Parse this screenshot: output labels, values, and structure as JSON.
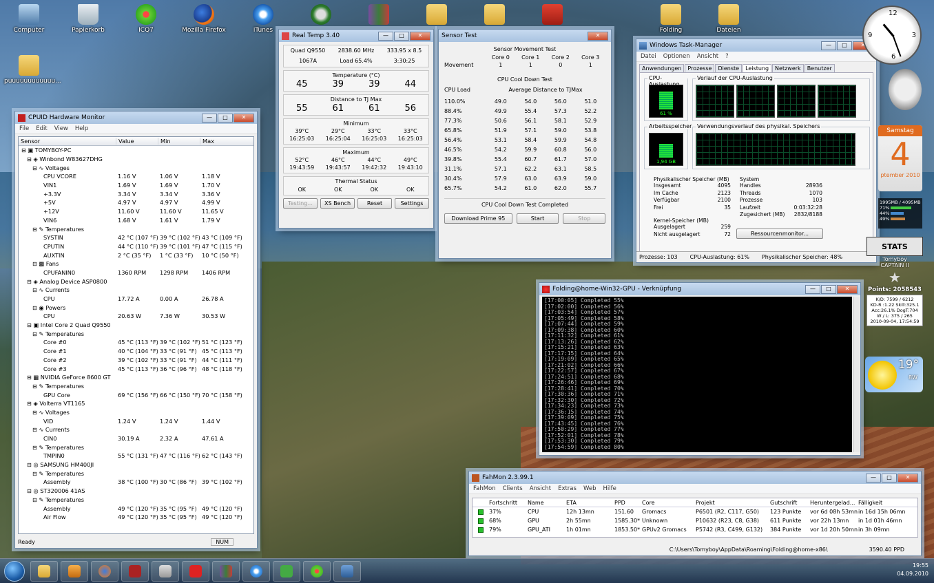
{
  "desktop": {
    "icons": [
      {
        "label": "Computer"
      },
      {
        "label": "Papierkorb"
      },
      {
        "label": "ICQ7"
      },
      {
        "label": "Mozilla Firefox"
      },
      {
        "label": "iTunes"
      },
      {
        "label": ""
      },
      {
        "label": ""
      },
      {
        "label": ""
      },
      {
        "label": ""
      },
      {
        "label": ""
      },
      {
        "label": "Folding"
      },
      {
        "label": "Dateien"
      },
      {
        "label": "puuuuuuuuuuuu..."
      }
    ]
  },
  "hwmon": {
    "title": "CPUID Hardware Monitor",
    "menu": [
      "File",
      "Edit",
      "View",
      "Help"
    ],
    "columns": [
      "Sensor",
      "Value",
      "Min",
      "Max"
    ],
    "rows": [
      {
        "sensor": "⊟ ▣ TOMYBOY-PC",
        "value": "",
        "min": "",
        "max": "",
        "indent": 0
      },
      {
        "sensor": "⊟ ◈ Winbond W83627DHG",
        "value": "",
        "min": "",
        "max": "",
        "indent": 1
      },
      {
        "sensor": "⊟ ∿ Voltages",
        "value": "",
        "min": "",
        "max": "",
        "indent": 2
      },
      {
        "sensor": "CPU VCORE",
        "value": "1.16 V",
        "min": "1.06 V",
        "max": "1.18 V",
        "indent": 4
      },
      {
        "sensor": "VIN1",
        "value": "1.69 V",
        "min": "1.69 V",
        "max": "1.70 V",
        "indent": 4
      },
      {
        "sensor": "+3.3V",
        "value": "3.34 V",
        "min": "3.34 V",
        "max": "3.36 V",
        "indent": 4
      },
      {
        "sensor": "+5V",
        "value": "4.97 V",
        "min": "4.97 V",
        "max": "4.99 V",
        "indent": 4
      },
      {
        "sensor": "+12V",
        "value": "11.60 V",
        "min": "11.60 V",
        "max": "11.65 V",
        "indent": 4
      },
      {
        "sensor": "VIN6",
        "value": "1.68 V",
        "min": "1.61 V",
        "max": "1.79 V",
        "indent": 4
      },
      {
        "sensor": "⊟ ✎ Temperatures",
        "value": "",
        "min": "",
        "max": "",
        "indent": 2
      },
      {
        "sensor": "SYSTIN",
        "value": "42 °C (107 °F)",
        "min": "39 °C (102 °F)",
        "max": "43 °C (109 °F)",
        "indent": 4
      },
      {
        "sensor": "CPUTIN",
        "value": "44 °C (110 °F)",
        "min": "39 °C (101 °F)",
        "max": "47 °C (115 °F)",
        "indent": 4
      },
      {
        "sensor": "AUXTIN",
        "value": "2 °C (35 °F)",
        "min": "1 °C (33 °F)",
        "max": "10 °C (50 °F)",
        "indent": 4
      },
      {
        "sensor": "⊟ ▩ Fans",
        "value": "",
        "min": "",
        "max": "",
        "indent": 2
      },
      {
        "sensor": "CPUFANIN0",
        "value": "1360 RPM",
        "min": "1298 RPM",
        "max": "1406 RPM",
        "indent": 4
      },
      {
        "sensor": "⊟ ◈ Analog Device ASP0800",
        "value": "",
        "min": "",
        "max": "",
        "indent": 1
      },
      {
        "sensor": "⊟ ∿ Currents",
        "value": "",
        "min": "",
        "max": "",
        "indent": 2
      },
      {
        "sensor": "CPU",
        "value": "17.72 A",
        "min": "0.00 A",
        "max": "26.78 A",
        "indent": 4
      },
      {
        "sensor": "⊟ ◉ Powers",
        "value": "",
        "min": "",
        "max": "",
        "indent": 2
      },
      {
        "sensor": "CPU",
        "value": "20.63 W",
        "min": "7.36 W",
        "max": "30.53 W",
        "indent": 4
      },
      {
        "sensor": "⊟ ▣ Intel Core 2 Quad Q9550",
        "value": "",
        "min": "",
        "max": "",
        "indent": 1
      },
      {
        "sensor": "⊟ ✎ Temperatures",
        "value": "",
        "min": "",
        "max": "",
        "indent": 2
      },
      {
        "sensor": "Core #0",
        "value": "45 °C (113 °F)",
        "min": "39 °C (102 °F)",
        "max": "51 °C (123 °F)",
        "indent": 4
      },
      {
        "sensor": "Core #1",
        "value": "40 °C (104 °F)",
        "min": "33 °C (91 °F)",
        "max": "45 °C (113 °F)",
        "indent": 4
      },
      {
        "sensor": "Core #2",
        "value": "39 °C (102 °F)",
        "min": "33 °C (91 °F)",
        "max": "44 °C (111 °F)",
        "indent": 4
      },
      {
        "sensor": "Core #3",
        "value": "45 °C (113 °F)",
        "min": "36 °C (96 °F)",
        "max": "48 °C (118 °F)",
        "indent": 4
      },
      {
        "sensor": "⊟ ▦ NVIDIA GeForce 8600 GT",
        "value": "",
        "min": "",
        "max": "",
        "indent": 1
      },
      {
        "sensor": "⊟ ✎ Temperatures",
        "value": "",
        "min": "",
        "max": "",
        "indent": 2
      },
      {
        "sensor": "GPU Core",
        "value": "69 °C (156 °F)",
        "min": "66 °C (150 °F)",
        "max": "70 °C (158 °F)",
        "indent": 4
      },
      {
        "sensor": "⊟ ◈ Volterra VT1165",
        "value": "",
        "min": "",
        "max": "",
        "indent": 1
      },
      {
        "sensor": "⊟ ∿ Voltages",
        "value": "",
        "min": "",
        "max": "",
        "indent": 2
      },
      {
        "sensor": "VID",
        "value": "1.24 V",
        "min": "1.24 V",
        "max": "1.44 V",
        "indent": 4
      },
      {
        "sensor": "⊟ ∿ Currents",
        "value": "",
        "min": "",
        "max": "",
        "indent": 2
      },
      {
        "sensor": "CIN0",
        "value": "30.19 A",
        "min": "2.32 A",
        "max": "47.61 A",
        "indent": 4
      },
      {
        "sensor": "⊟ ✎ Temperatures",
        "value": "",
        "min": "",
        "max": "",
        "indent": 2
      },
      {
        "sensor": "TMPIN0",
        "value": "55 °C (131 °F)",
        "min": "47 °C (116 °F)",
        "max": "62 °C (143 °F)",
        "indent": 4
      },
      {
        "sensor": "⊟ ◎ SAMSUNG HM400JI",
        "value": "",
        "min": "",
        "max": "",
        "indent": 1
      },
      {
        "sensor": "⊟ ✎ Temperatures",
        "value": "",
        "min": "",
        "max": "",
        "indent": 2
      },
      {
        "sensor": "Assembly",
        "value": "38 °C (100 °F)",
        "min": "30 °C (86 °F)",
        "max": "39 °C (102 °F)",
        "indent": 4
      },
      {
        "sensor": "⊟ ◎ ST320006 41AS",
        "value": "",
        "min": "",
        "max": "",
        "indent": 1
      },
      {
        "sensor": "⊟ ✎ Temperatures",
        "value": "",
        "min": "",
        "max": "",
        "indent": 2
      },
      {
        "sensor": "Assembly",
        "value": "49 °C (120 °F)",
        "min": "35 °C (95 °F)",
        "max": "49 °C (120 °F)",
        "indent": 4
      },
      {
        "sensor": "Air Flow",
        "value": "49 °C (120 °F)",
        "min": "35 °C (95 °F)",
        "max": "49 °C (120 °F)",
        "indent": 4
      }
    ],
    "status": "Ready",
    "num": "NUM"
  },
  "realtemp": {
    "title": "Real Temp 3.40",
    "cpu": "Quad Q9550",
    "mhz": "2838.60 MHz",
    "mult": "333.95 x 8.5",
    "vid": "1067A",
    "load": "Load  65.4%",
    "time": "3:30:25",
    "temp_label": "Temperature (°C)",
    "temps": [
      "45",
      "39",
      "39",
      "44"
    ],
    "tj_label": "Distance to TJ Max",
    "tj": [
      "55",
      "61",
      "61",
      "56"
    ],
    "min_label": "Minimum",
    "min_t": [
      "39°C",
      "29°C",
      "33°C",
      "33°C"
    ],
    "min_time": [
      "16:25:03",
      "16:25:04",
      "16:25:03",
      "16:25:03"
    ],
    "max_label": "Maximum",
    "max_t": [
      "52°C",
      "46°C",
      "44°C",
      "49°C"
    ],
    "max_time": [
      "19:43:59",
      "19:43:57",
      "19:42:32",
      "19:43:10"
    ],
    "thermal_label": "Thermal Status",
    "thermal": [
      "OK",
      "OK",
      "OK",
      "OK"
    ],
    "buttons": [
      "Testing...",
      "XS Bench",
      "Reset",
      "Settings"
    ]
  },
  "sensortest": {
    "title": "Sensor Test",
    "movement_title": "Sensor Movement Test",
    "cores": [
      "Core 0",
      "Core 1",
      "Core 2",
      "Core 3"
    ],
    "movement_label": "Movement",
    "movement": [
      "1",
      "1",
      "0",
      "1"
    ],
    "cooldown_title": "CPU Cool Down Test",
    "cpu_load_label": "CPU Load",
    "avg_label": "Average Distance to TJMax",
    "rows": [
      [
        "110.0%",
        "49.0",
        "54.0",
        "56.0",
        "51.0"
      ],
      [
        "88.4%",
        "49.9",
        "55.4",
        "57.3",
        "52.2"
      ],
      [
        "77.3%",
        "50.6",
        "56.1",
        "58.1",
        "52.9"
      ],
      [
        "65.8%",
        "51.9",
        "57.1",
        "59.0",
        "53.8"
      ],
      [
        "56.4%",
        "53.1",
        "58.4",
        "59.9",
        "54.8"
      ],
      [
        "46.5%",
        "54.2",
        "59.9",
        "60.8",
        "56.0"
      ],
      [
        "39.8%",
        "55.4",
        "60.7",
        "61.7",
        "57.0"
      ],
      [
        "31.1%",
        "57.1",
        "62.2",
        "63.1",
        "58.5"
      ],
      [
        "30.4%",
        "57.9",
        "63.0",
        "63.9",
        "59.0"
      ],
      [
        "65.7%",
        "54.2",
        "61.0",
        "62.0",
        "55.7"
      ]
    ],
    "completed": "CPU Cool Down Test Completed",
    "btn_download": "Download Prime 95",
    "btn_start": "Start",
    "btn_stop": "Stop"
  },
  "taskmgr": {
    "title": "Windows Task-Manager",
    "menu": [
      "Datei",
      "Optionen",
      "Ansicht",
      "?"
    ],
    "tabs": [
      "Anwendungen",
      "Prozesse",
      "Dienste",
      "Leistung",
      "Netzwerk",
      "Benutzer"
    ],
    "cpu_usage_label": "CPU-Auslastung",
    "cpu_usage": "61 %",
    "cpu_history_label": "Verlauf der CPU-Auslastung",
    "mem_label": "Arbeitsspeicher",
    "mem_value": "1,94 GB",
    "mem_history_label": "Verwendungsverlauf des physikal. Speichers",
    "phys_title": "Physikalischer Speicher (MB)",
    "phys": [
      [
        "Insgesamt",
        "4095"
      ],
      [
        "Im Cache",
        "2123"
      ],
      [
        "Verfügbar",
        "2100"
      ],
      [
        "Frei",
        "35"
      ]
    ],
    "kernel_title": "Kernel-Speicher (MB)",
    "kernel": [
      [
        "Ausgelagert",
        "259"
      ],
      [
        "Nicht ausgelagert",
        "72"
      ]
    ],
    "system_title": "System",
    "system": [
      [
        "Handles",
        "28936"
      ],
      [
        "Threads",
        "1070"
      ],
      [
        "Prozesse",
        "103"
      ],
      [
        "Laufzeit",
        "0:03:32:28"
      ],
      [
        "Zugesichert (MB)",
        "2832/8188"
      ]
    ],
    "resmon_button": "Ressourcenmonitor...",
    "status": [
      "Prozesse: 103",
      "CPU-Auslastung: 61%",
      "Physikalischer Speicher: 48%"
    ]
  },
  "console": {
    "title": "Folding@home-Win32-GPU - Verknüpfung",
    "lines": [
      "[17:00:05] Completed 55%",
      "[17:02:00] Completed 56%",
      "[17:03:54] Completed 57%",
      "[17:05:49] Completed 58%",
      "[17:07:44] Completed 59%",
      "[17:09:38] Completed 60%",
      "[17:11:32] Completed 61%",
      "[17:13:26] Completed 62%",
      "[17:15:21] Completed 63%",
      "[17:17:15] Completed 64%",
      "[17:19:09] Completed 65%",
      "[17:21:02] Completed 66%",
      "[17:22:57] Completed 67%",
      "[17:24:51] Completed 68%",
      "[17:26:46] Completed 69%",
      "[17:28:41] Completed 70%",
      "[17:30:36] Completed 71%",
      "[17:32:30] Completed 72%",
      "[17:34:23] Completed 73%",
      "[17:36:15] Completed 74%",
      "[17:39:09] Completed 75%",
      "[17:43:45] Completed 76%",
      "[17:50:29] Completed 77%",
      "[17:52:01] Completed 78%",
      "[17:53:30] Completed 79%",
      "[17:54:59] Completed 80%"
    ]
  },
  "fahmon": {
    "title": "FahMon 2.3.99.1",
    "menu": [
      "FahMon",
      "Clients",
      "Ansicht",
      "Extras",
      "Web",
      "Hilfe"
    ],
    "columns": [
      "Fortschritt",
      "Name",
      "ETA",
      "PPD",
      "Core",
      "Projekt",
      "Gutschrift",
      "Heruntergelad...",
      "Fälligkeit"
    ],
    "rows": [
      [
        "37%",
        "CPU",
        "12h 13mn",
        "151.60",
        "Gromacs",
        "P6501 (R2, C117, G50)",
        "123 Punkte",
        "vor 6d 08h 53mn",
        "in 16d 15h 06mn"
      ],
      [
        "68%",
        "GPU",
        "2h 55mn",
        "1585.30*",
        "Unknown",
        "P10632 (R23, C8, G38)",
        "611 Punkte",
        "vor 22h 13mn",
        "in 1d 01h 46mn"
      ],
      [
        "79%",
        "GPU_ATI",
        "1h 01mn",
        "1853.50*",
        "GPUv2 Gromacs",
        "P5742 (R3, C499, G132)",
        "384 Punkte",
        "vor 1d 20h 50mn",
        "in 3h 09mn"
      ]
    ],
    "path": "C:\\Users\\Tomyboy\\AppData\\Roaming\\Folding@home-x86\\",
    "total_ppd": "3590.40 PPD"
  },
  "gadgets": {
    "clock_numbers": [
      "12",
      "3",
      "6",
      "9"
    ],
    "calendar_day_name": "Samstag",
    "calendar_day": "4",
    "calendar_month": "ptember 2010",
    "mem_bar_text": "1995MB / 4095MB",
    "bars": [
      "71%",
      "44%",
      "49%"
    ],
    "folding_title": "STATS",
    "folding_user": "Tomyboy",
    "folding_rank": "CAPTAIN II",
    "folding_points": "Points: 2058543",
    "folding_stats": [
      "K/D: 7599 / 6212",
      "KD-R :1.22  Skill:325.1",
      "Acc:26.1%  DogT:704",
      "W / L: 375 / 265",
      "2010-09-04, 17:54:59"
    ],
    "weather_temp": "19°",
    "weather_wind": "8W"
  },
  "taskbar": {
    "time": "19:55",
    "date": "04.09.2010"
  }
}
